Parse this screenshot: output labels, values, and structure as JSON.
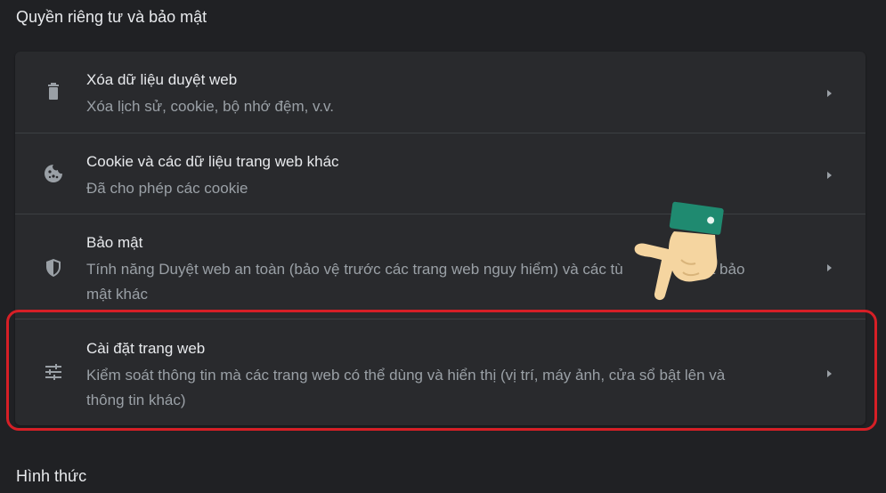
{
  "section_privacy": {
    "title": "Quyền riêng tư và bảo mật"
  },
  "rows": [
    {
      "id": "clear-browsing-data",
      "label": "Xóa dữ liệu duyệt web",
      "description": "Xóa lịch sử, cookie, bộ nhớ đệm, v.v.",
      "icon": "trash-icon"
    },
    {
      "id": "cookies",
      "label": "Cookie và các dữ liệu trang web khác",
      "description": "Đã cho phép các cookie",
      "icon": "cookie-icon"
    },
    {
      "id": "security",
      "label": "Bảo mật",
      "description_line1": "Tính năng Duyệt web an toàn (bảo vệ trước các trang web nguy hiểm) và các tù",
      "description_line1_tail": "ài đặt bảo",
      "description_line2": "mật khác",
      "icon": "shield-icon"
    },
    {
      "id": "site-settings",
      "label": "Cài đặt trang web",
      "description_line1": "Kiểm soát thông tin mà các trang web có thể dùng và hiển thị (vị trí, máy ảnh, cửa sổ bật lên và",
      "description_line2": "thông tin khác)",
      "icon": "tune-sliders-icon"
    }
  ],
  "section_appearance": {
    "title": "Hình thức"
  },
  "colors": {
    "background": "#202124",
    "card": "#292a2d",
    "primary_text": "#e8eaed",
    "secondary_text": "#9aa0a6",
    "highlight_border": "#d61f26",
    "hand_sleeve": "#1f8a70",
    "hand_skin": "#f5d5a0"
  }
}
